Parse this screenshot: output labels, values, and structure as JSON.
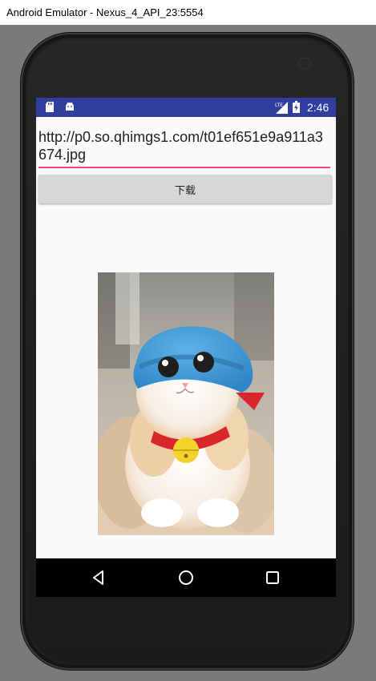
{
  "window": {
    "title": "Android Emulator - Nexus_4_API_23:5554"
  },
  "status_bar": {
    "time": "2:46",
    "network": "LTE",
    "bar_color": "#303f9f",
    "icons": [
      "sd-card-icon",
      "android-icon",
      "lte-signal-icon",
      "battery-charging-icon"
    ]
  },
  "app": {
    "url_input": {
      "value": "http://p0.so.qhimgs1.com/t01ef651e9a911a3674.jpg"
    },
    "download_button": {
      "label": "下载"
    },
    "accent_color": "#ff4081"
  },
  "nav_bar": {
    "icons": [
      "back-icon",
      "home-icon",
      "recents-icon"
    ]
  }
}
